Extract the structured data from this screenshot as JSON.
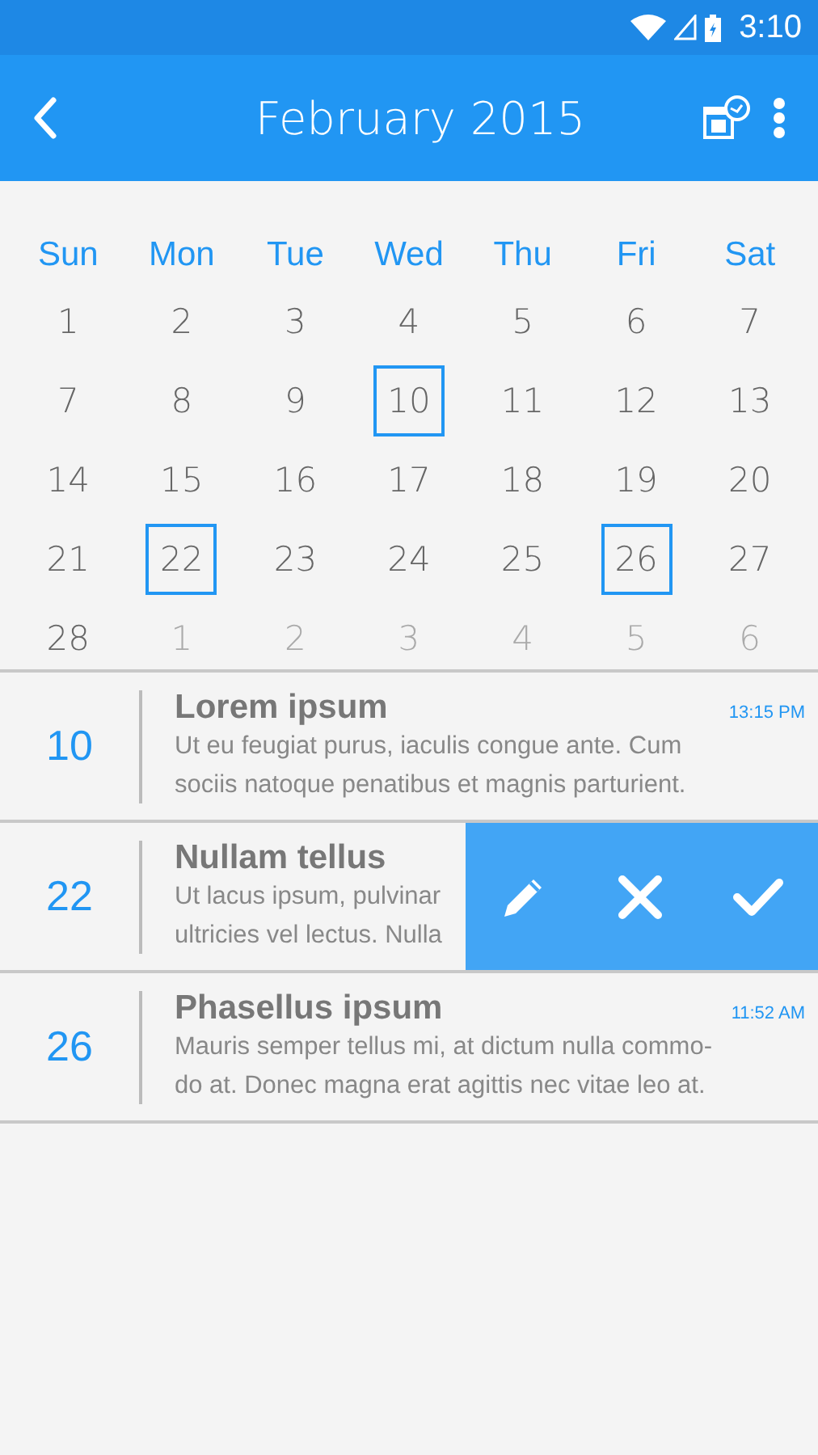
{
  "status_bar": {
    "time": "3:10"
  },
  "app_bar": {
    "title": "February 2015"
  },
  "weekdays": [
    "Sun",
    "Mon",
    "Tue",
    "Wed",
    "Thu",
    "Fri",
    "Sat"
  ],
  "weeks": [
    [
      {
        "label": "1",
        "muted": false,
        "marked": false
      },
      {
        "label": "2",
        "muted": false,
        "marked": false
      },
      {
        "label": "3",
        "muted": false,
        "marked": false
      },
      {
        "label": "4",
        "muted": false,
        "marked": false
      },
      {
        "label": "5",
        "muted": false,
        "marked": false
      },
      {
        "label": "6",
        "muted": false,
        "marked": false
      },
      {
        "label": "7",
        "muted": false,
        "marked": false
      }
    ],
    [
      {
        "label": "7",
        "muted": false,
        "marked": false
      },
      {
        "label": "8",
        "muted": false,
        "marked": false
      },
      {
        "label": "9",
        "muted": false,
        "marked": false
      },
      {
        "label": "10",
        "muted": false,
        "marked": true
      },
      {
        "label": "11",
        "muted": false,
        "marked": false
      },
      {
        "label": "12",
        "muted": false,
        "marked": false
      },
      {
        "label": "13",
        "muted": false,
        "marked": false
      }
    ],
    [
      {
        "label": "14",
        "muted": false,
        "marked": false
      },
      {
        "label": "15",
        "muted": false,
        "marked": false
      },
      {
        "label": "16",
        "muted": false,
        "marked": false
      },
      {
        "label": "17",
        "muted": false,
        "marked": false
      },
      {
        "label": "18",
        "muted": false,
        "marked": false
      },
      {
        "label": "19",
        "muted": false,
        "marked": false
      },
      {
        "label": "20",
        "muted": false,
        "marked": false
      }
    ],
    [
      {
        "label": "21",
        "muted": false,
        "marked": false
      },
      {
        "label": "22",
        "muted": false,
        "marked": true
      },
      {
        "label": "23",
        "muted": false,
        "marked": false
      },
      {
        "label": "24",
        "muted": false,
        "marked": false
      },
      {
        "label": "25",
        "muted": false,
        "marked": false
      },
      {
        "label": "26",
        "muted": false,
        "marked": true
      },
      {
        "label": "27",
        "muted": false,
        "marked": false
      }
    ],
    [
      {
        "label": "28",
        "muted": false,
        "marked": false
      },
      {
        "label": "1",
        "muted": true,
        "marked": false
      },
      {
        "label": "2",
        "muted": true,
        "marked": false
      },
      {
        "label": "3",
        "muted": true,
        "marked": false
      },
      {
        "label": "4",
        "muted": true,
        "marked": false
      },
      {
        "label": "5",
        "muted": true,
        "marked": false
      },
      {
        "label": "6",
        "muted": true,
        "marked": false
      }
    ]
  ],
  "events": [
    {
      "day": "10",
      "title": "Lorem ipsum",
      "time": "13:15 PM",
      "lines": [
        "Ut eu feugiat purus, iaculis congue ante. Cum",
        "sociis natoque penatibus et magnis parturient."
      ],
      "swiped": false
    },
    {
      "day": "22",
      "title": "Nullam tellus",
      "lines": [
        "Ut lacus ipsum, pulvinar",
        "ultricies vel lectus. Nulla"
      ],
      "swiped": true
    },
    {
      "day": "26",
      "title": "Phasellus ipsum",
      "time": "11:52 AM",
      "lines": [
        "Mauris semper tellus mi, at dictum nulla commo-",
        "do at. Donec magna erat agittis nec vitae leo at."
      ],
      "swiped": false
    }
  ]
}
